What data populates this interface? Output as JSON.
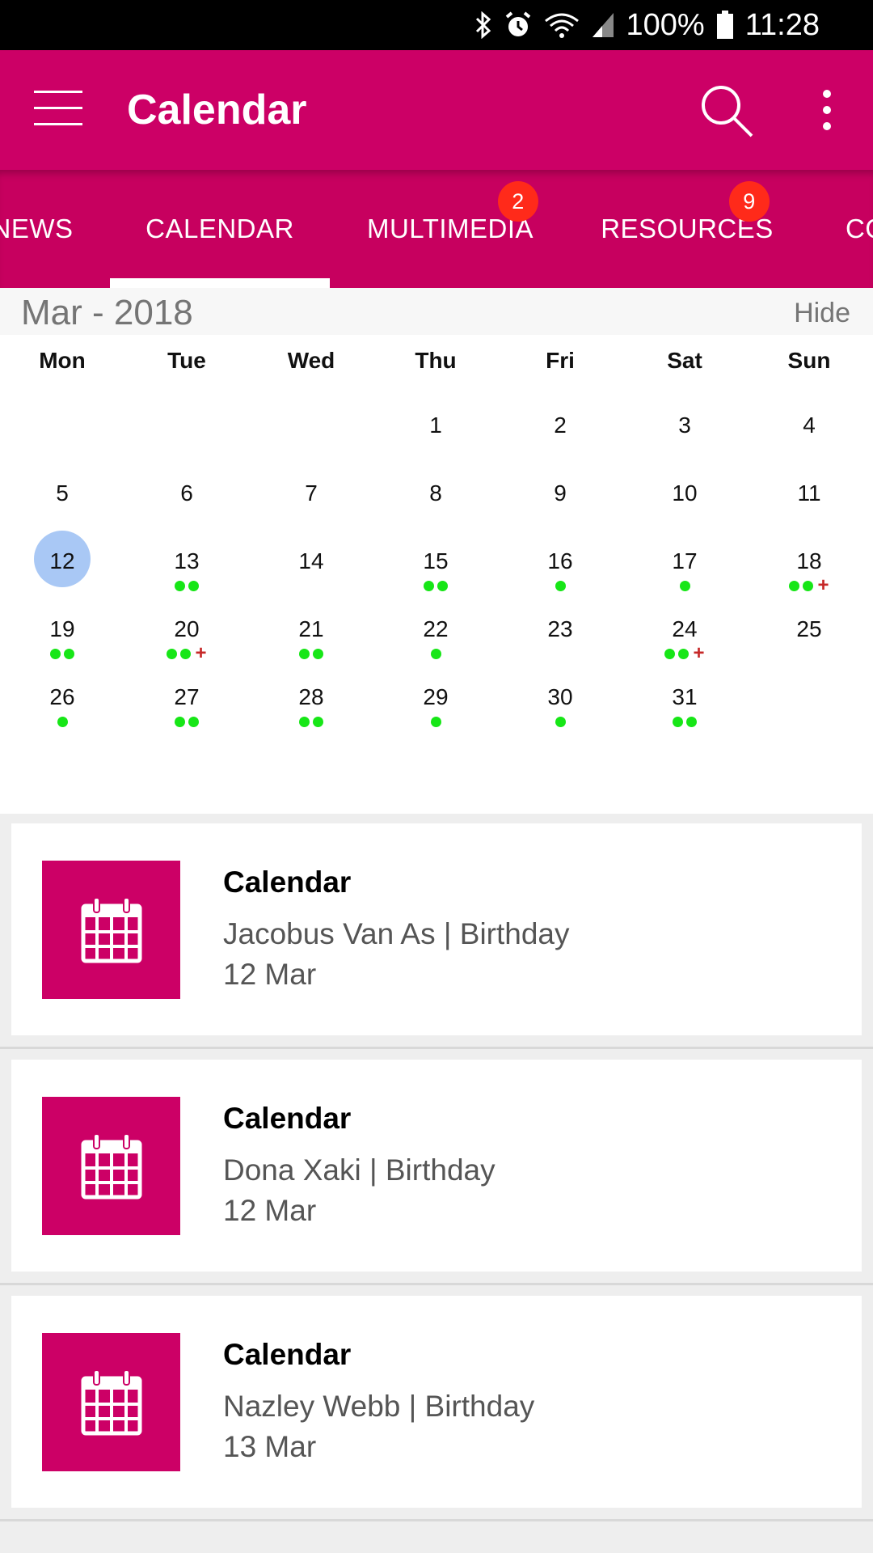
{
  "status_bar": {
    "battery": "100%",
    "time": "11:28",
    "icons": [
      "bluetooth-icon",
      "alarm-icon",
      "wifi-icon",
      "signal-icon",
      "battery-icon"
    ]
  },
  "app_bar": {
    "title": "Calendar",
    "menu_icon": "hamburger-icon",
    "search_icon": "search-icon",
    "more_icon": "more-vertical-icon",
    "color": "#cc0066"
  },
  "tabs": [
    {
      "label": "NEWS",
      "badge": ""
    },
    {
      "label": "CALENDAR",
      "badge": "",
      "active": true
    },
    {
      "label": "MULTIMEDIA",
      "badge": "2"
    },
    {
      "label": "RESOURCES",
      "badge": "9"
    },
    {
      "label": "CO",
      "badge": ""
    }
  ],
  "calendar": {
    "month_label": "Mar - 2018",
    "hide_label": "Hide",
    "weekdays": [
      "Mon",
      "Tue",
      "Wed",
      "Thu",
      "Fri",
      "Sat",
      "Sun"
    ],
    "today": "12",
    "weeks": [
      [
        null,
        null,
        null,
        {
          "d": "1",
          "dots": 0
        },
        {
          "d": "2",
          "dots": 0
        },
        {
          "d": "3",
          "dots": 0
        },
        {
          "d": "4",
          "dots": 0
        }
      ],
      [
        {
          "d": "5",
          "dots": 0
        },
        {
          "d": "6",
          "dots": 0
        },
        {
          "d": "7",
          "dots": 0
        },
        {
          "d": "8",
          "dots": 0
        },
        {
          "d": "9",
          "dots": 0
        },
        {
          "d": "10",
          "dots": 0
        },
        {
          "d": "11",
          "dots": 0
        }
      ],
      [
        {
          "d": "12",
          "dots": 0
        },
        {
          "d": "13",
          "dots": 2
        },
        {
          "d": "14",
          "dots": 0
        },
        {
          "d": "15",
          "dots": 2
        },
        {
          "d": "16",
          "dots": 1
        },
        {
          "d": "17",
          "dots": 1
        },
        {
          "d": "18",
          "dots": 2,
          "plus": true
        }
      ],
      [
        {
          "d": "19",
          "dots": 2
        },
        {
          "d": "20",
          "dots": 2,
          "plus": true
        },
        {
          "d": "21",
          "dots": 2
        },
        {
          "d": "22",
          "dots": 1
        },
        {
          "d": "23",
          "dots": 0
        },
        {
          "d": "24",
          "dots": 2,
          "plus": true
        },
        {
          "d": "25",
          "dots": 0
        }
      ],
      [
        {
          "d": "26",
          "dots": 1
        },
        {
          "d": "27",
          "dots": 2
        },
        {
          "d": "28",
          "dots": 2
        },
        {
          "d": "29",
          "dots": 1
        },
        {
          "d": "30",
          "dots": 1
        },
        {
          "d": "31",
          "dots": 2
        },
        null
      ]
    ],
    "event_dot_color": "#17e617",
    "today_color": "#a9c8f5"
  },
  "events": [
    {
      "title": "Calendar",
      "subtitle": "Jacobus Van As | Birthday",
      "date": "12 Mar",
      "icon": "calendar-icon"
    },
    {
      "title": "Calendar",
      "subtitle": "Dona Xaki | Birthday",
      "date": "12 Mar",
      "icon": "calendar-icon"
    },
    {
      "title": "Calendar",
      "subtitle": "Nazley Webb | Birthday",
      "date": "13 Mar",
      "icon": "calendar-icon"
    }
  ]
}
